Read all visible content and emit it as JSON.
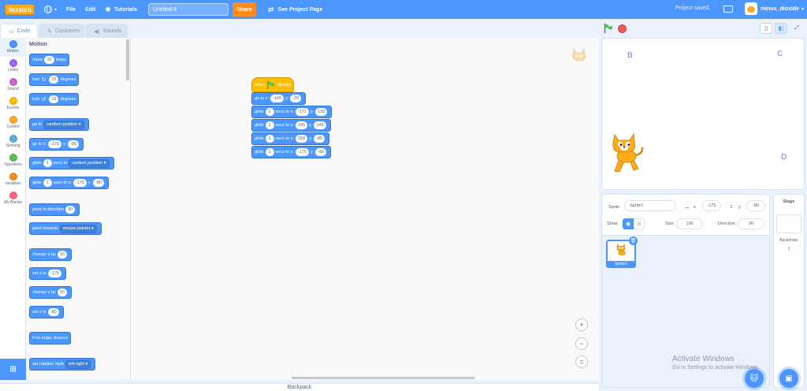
{
  "menubar": {
    "logo": "Scratch",
    "file": "File",
    "edit": "Edit",
    "tutorials": "Tutorials",
    "project_title": "Untitled-9",
    "share": "Share",
    "see_project_page": "See Project Page",
    "save_status": "Project saved.",
    "username": "minus_dioxide"
  },
  "tabs": {
    "code": "Code",
    "costumes": "Costumes",
    "sounds": "Sounds"
  },
  "categories": [
    {
      "label": "Motion",
      "color": "#4c97ff"
    },
    {
      "label": "Looks",
      "color": "#9966ff"
    },
    {
      "label": "Sound",
      "color": "#cf63cf"
    },
    {
      "label": "Events",
      "color": "#ffbf00"
    },
    {
      "label": "Control",
      "color": "#ffab19"
    },
    {
      "label": "Sensing",
      "color": "#5cb1d6"
    },
    {
      "label": "Operators",
      "color": "#59c059"
    },
    {
      "label": "Variables",
      "color": "#ff8c1a"
    },
    {
      "label": "My Blocks",
      "color": "#ff6680"
    }
  ],
  "palette": {
    "heading": "Motion",
    "move": {
      "t1": "move",
      "v": "10",
      "t2": "steps"
    },
    "turn_right": {
      "t1": "turn",
      "v": "15",
      "t2": "degrees"
    },
    "turn_left": {
      "t1": "turn",
      "v": "15",
      "t2": "degrees"
    },
    "go_to": {
      "t1": "go to",
      "v": "random position"
    },
    "go_to_xy": {
      "t1": "go to x:",
      "x": "-175",
      "t2": "y:",
      "y": "-80"
    },
    "glide_to": {
      "t1": "glide",
      "v": "1",
      "t2": "secs to",
      "dd": "random position"
    },
    "glide_xy": {
      "t1": "glide",
      "v": "1",
      "t2": "secs to x:",
      "x": "-175",
      "t3": "y:",
      "y": "-80"
    },
    "point_dir": {
      "t1": "point in direction",
      "v": "90"
    },
    "point_towards": {
      "t1": "point towards",
      "v": "mouse pointer"
    },
    "change_x": {
      "t1": "change x by",
      "v": "10"
    },
    "set_x": {
      "t1": "set x to",
      "v": "-175"
    },
    "change_y": {
      "t1": "change y by",
      "v": "10"
    },
    "set_y": {
      "t1": "set y to",
      "v": "-80"
    },
    "bounce": {
      "t1": "if on edge, bounce"
    },
    "rotation": {
      "t1": "set rotation style",
      "v": "left-right"
    }
  },
  "script": {
    "hat": {
      "t1": "when",
      "t2": "clicked"
    },
    "goto": {
      "t1": "go to x:",
      "x": "-140",
      "t2": "y:",
      "y": "-20"
    },
    "glides": [
      {
        "t1": "glide",
        "s": "1",
        "t2": "secs to x:",
        "x": "-171",
        "t3": "y:",
        "y": "133"
      },
      {
        "t1": "glide",
        "s": "1",
        "t2": "secs to x:",
        "x": "190",
        "t3": "y:",
        "y": "149"
      },
      {
        "t1": "glide",
        "s": "1",
        "t2": "secs to x:",
        "x": "159",
        "t3": "y:",
        "y": "-85"
      },
      {
        "t1": "glide",
        "s": "1",
        "t2": "secs to x:",
        "x": "-175",
        "t3": "y:",
        "y": "-80"
      }
    ]
  },
  "zoom": {
    "in": "+",
    "out": "−",
    "reset": "="
  },
  "backpack": "Backpack",
  "stage": {
    "letters": {
      "b": "B",
      "c": "C",
      "d": "D"
    }
  },
  "sprite_info": {
    "sprite_label": "Sprite",
    "sprite_name": "Sprite1",
    "x_label": "x",
    "x": "-175",
    "y_label": "y",
    "y": "-80",
    "show_label": "Show",
    "size_label": "Size",
    "size": "100",
    "direction_label": "Direction",
    "direction": "90"
  },
  "sprite_list": [
    {
      "name": "Sprite1"
    }
  ],
  "stage_pane": {
    "title": "Stage",
    "backdrops_label": "Backdrops",
    "backdrops_count": "1"
  },
  "windows": {
    "line1": "Activate Windows",
    "line2": "Go to Settings to activate Windows."
  },
  "colors": {
    "motion": "#4c97ff",
    "events": "#ffbf00",
    "accent": "#4c97ff",
    "share": "#ff8c1a"
  }
}
